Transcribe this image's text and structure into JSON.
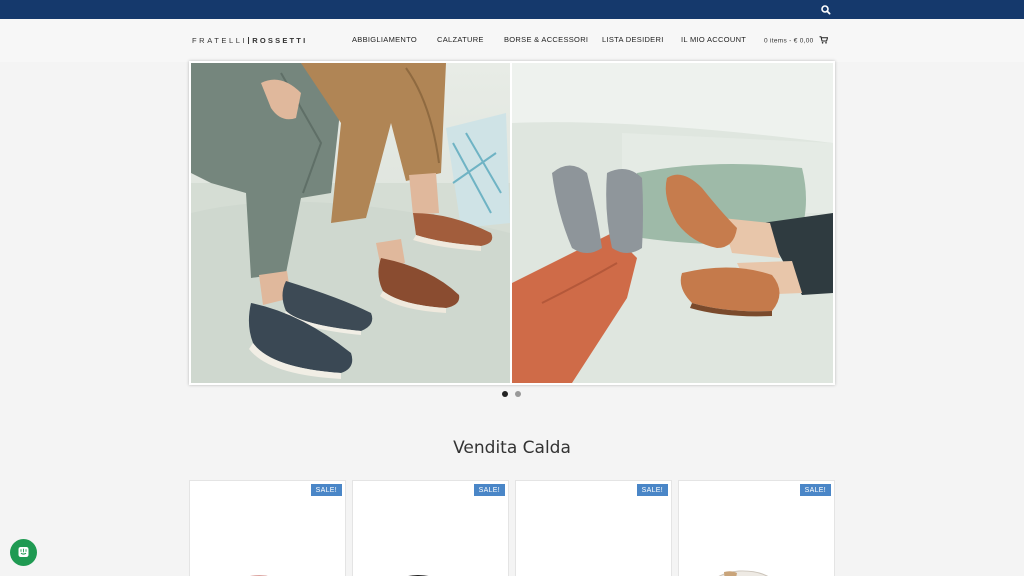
{
  "topbar": {
    "search_icon": "search-icon",
    "color": "#15396c"
  },
  "header": {
    "logo": {
      "part1": "FRATELLI",
      "part2": "ROSSETTI"
    },
    "nav": [
      {
        "label": "ABBIGLIAMENTO"
      },
      {
        "label": "CALZATURE"
      },
      {
        "label": "BORSE & ACCESSORI"
      },
      {
        "label": "LISTA DESIDERI"
      },
      {
        "label": "IL MIO ACCOUNT"
      }
    ],
    "cart": {
      "label": "0 items - € 0,00",
      "icon": "cart-icon"
    }
  },
  "slider": {
    "active_index": 0,
    "dots": [
      {
        "active": true
      },
      {
        "active": false
      }
    ]
  },
  "section": {
    "title": "Vendita Calda"
  },
  "products": [
    {
      "badge": "SALE!"
    },
    {
      "badge": "SALE!"
    },
    {
      "badge": "SALE!"
    },
    {
      "badge": "SALE!"
    }
  ],
  "chat": {
    "icon": "chat-icon"
  },
  "colors": {
    "accent": "#4a86c7",
    "topbar": "#15396c",
    "chat": "#1f9a52"
  }
}
